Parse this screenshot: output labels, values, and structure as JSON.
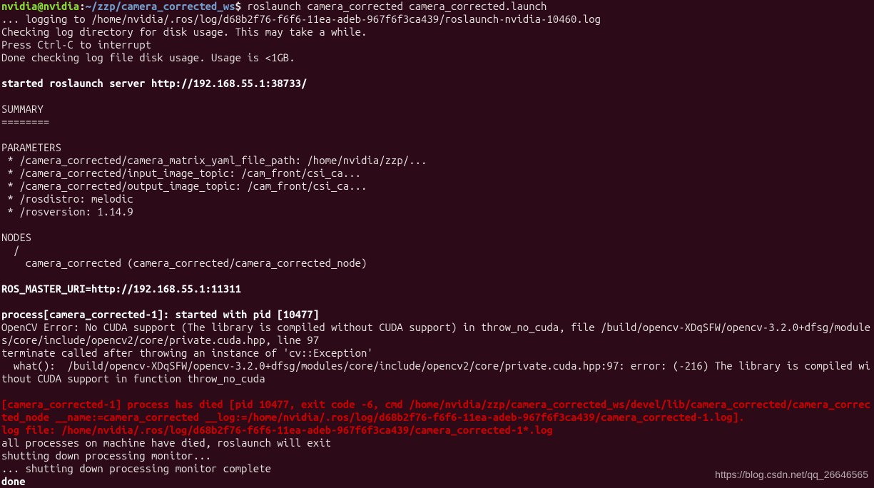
{
  "prompt": {
    "user": "nvidia@nvidia",
    "sep1": ":",
    "path": "~/zzp/camera_corrected_ws",
    "sep2": "$ "
  },
  "command": "roslaunch camera_corrected camera_corrected.launch",
  "log": {
    "logging": "... logging to /home/nvidia/.ros/log/d68b2f76-f6f6-11ea-adeb-967f6f3ca439/roslaunch-nvidia-10460.log",
    "check1": "Checking log directory for disk usage. This may take a while.",
    "check2": "Press Ctrl-C to interrupt",
    "check3": "Done checking log file disk usage. Usage is <1GB.",
    "server": "started roslaunch server http://192.168.55.1:38733/",
    "summary_hdr": "SUMMARY",
    "summary_sep": "========",
    "params_hdr": "PARAMETERS",
    "p1": " * /camera_corrected/camera_matrix_yaml_file_path: /home/nvidia/zzp/...",
    "p2": " * /camera_corrected/input_image_topic: /cam_front/csi_ca...",
    "p3": " * /camera_corrected/output_image_topic: /cam_front/csi_ca...",
    "p4": " * /rosdistro: melodic",
    "p5": " * /rosversion: 1.14.9",
    "nodes_hdr": "NODES",
    "nodes_root": "  /",
    "nodes_line": "    camera_corrected (camera_corrected/camera_corrected_node)",
    "master": "ROS_MASTER_URI=http://192.168.55.1:11311",
    "proc_start": "process[camera_corrected-1]: started with pid [10477]",
    "ocv1": "OpenCV Error: No CUDA support (The library is compiled without CUDA support) in throw_no_cuda, file /build/opencv-XDqSFW/opencv-3.2.0+dfsg/modules/core/include/opencv2/core/private.cuda.hpp, line 97",
    "ocv2": "terminate called after throwing an instance of 'cv::Exception'",
    "ocv3": "  what():  /build/opencv-XDqSFW/opencv-3.2.0+dfsg/modules/core/include/opencv2/core/private.cuda.hpp:97: error: (-216) The library is compiled without CUDA support in function throw_no_cuda",
    "err1": "[camera_corrected-1] process has died [pid 10477, exit code -6, cmd /home/nvidia/zzp/camera_corrected_ws/devel/lib/camera_corrected/camera_corrected_node __name:=camera_corrected __log:=/home/nvidia/.ros/log/d68b2f76-f6f6-11ea-adeb-967f6f3ca439/camera_corrected-1.log].",
    "err2": "log file: /home/nvidia/.ros/log/d68b2f76-f6f6-11ea-adeb-967f6f3ca439/camera_corrected-1*.log",
    "shut1": "all processes on machine have died, roslaunch will exit",
    "shut2": "shutting down processing monitor...",
    "shut3": "... shutting down processing monitor complete",
    "done": "done"
  },
  "watermark": "https://blog.csdn.net/qq_26646565"
}
